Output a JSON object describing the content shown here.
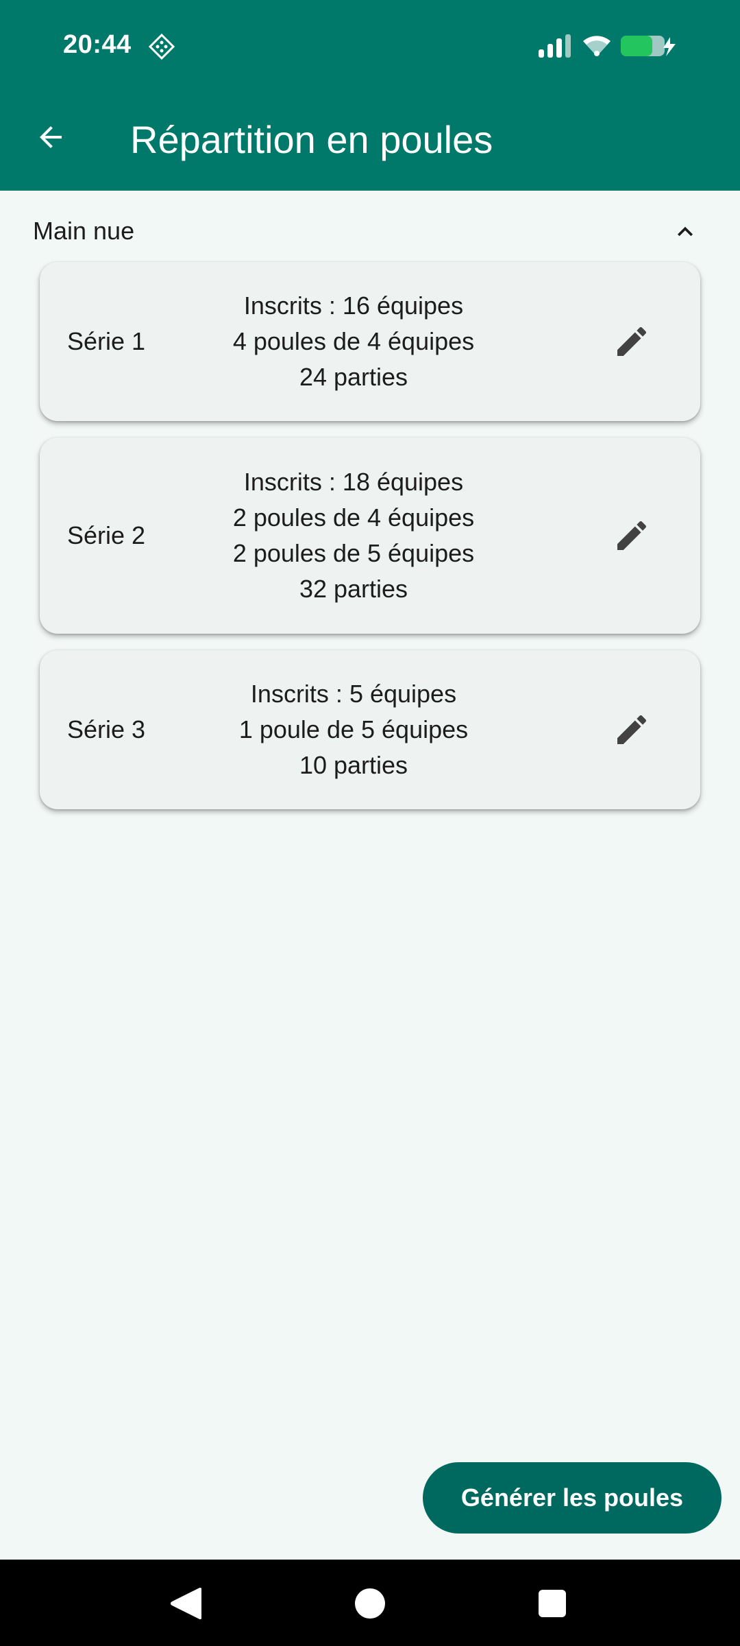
{
  "status_bar": {
    "time": "20:44"
  },
  "app_bar": {
    "title": "Répartition en poules"
  },
  "section": {
    "label": "Main nue"
  },
  "cards": [
    {
      "serie": "Série 1",
      "lines": [
        "Inscrits : 16 équipes",
        "4 poules de 4 équipes",
        "24 parties"
      ]
    },
    {
      "serie": "Série 2",
      "lines": [
        "Inscrits : 18 équipes",
        "2 poules de 4 équipes",
        "2 poules de 5 équipes",
        "32 parties"
      ]
    },
    {
      "serie": "Série 3",
      "lines": [
        "Inscrits : 5 équipes",
        "1 poule de 5 équipes",
        "10 parties"
      ]
    }
  ],
  "fab": {
    "label": "Générer les poules"
  },
  "colors": {
    "primary": "#00796b",
    "fab": "#00695f",
    "background": "#f2f8f6",
    "card": "#eef3f2",
    "battery": "#22c55e"
  },
  "icons": [
    "back-arrow-icon",
    "chevron-up-icon",
    "edit-pencil-icon",
    "signal-icon",
    "wifi-icon",
    "battery-icon"
  ]
}
